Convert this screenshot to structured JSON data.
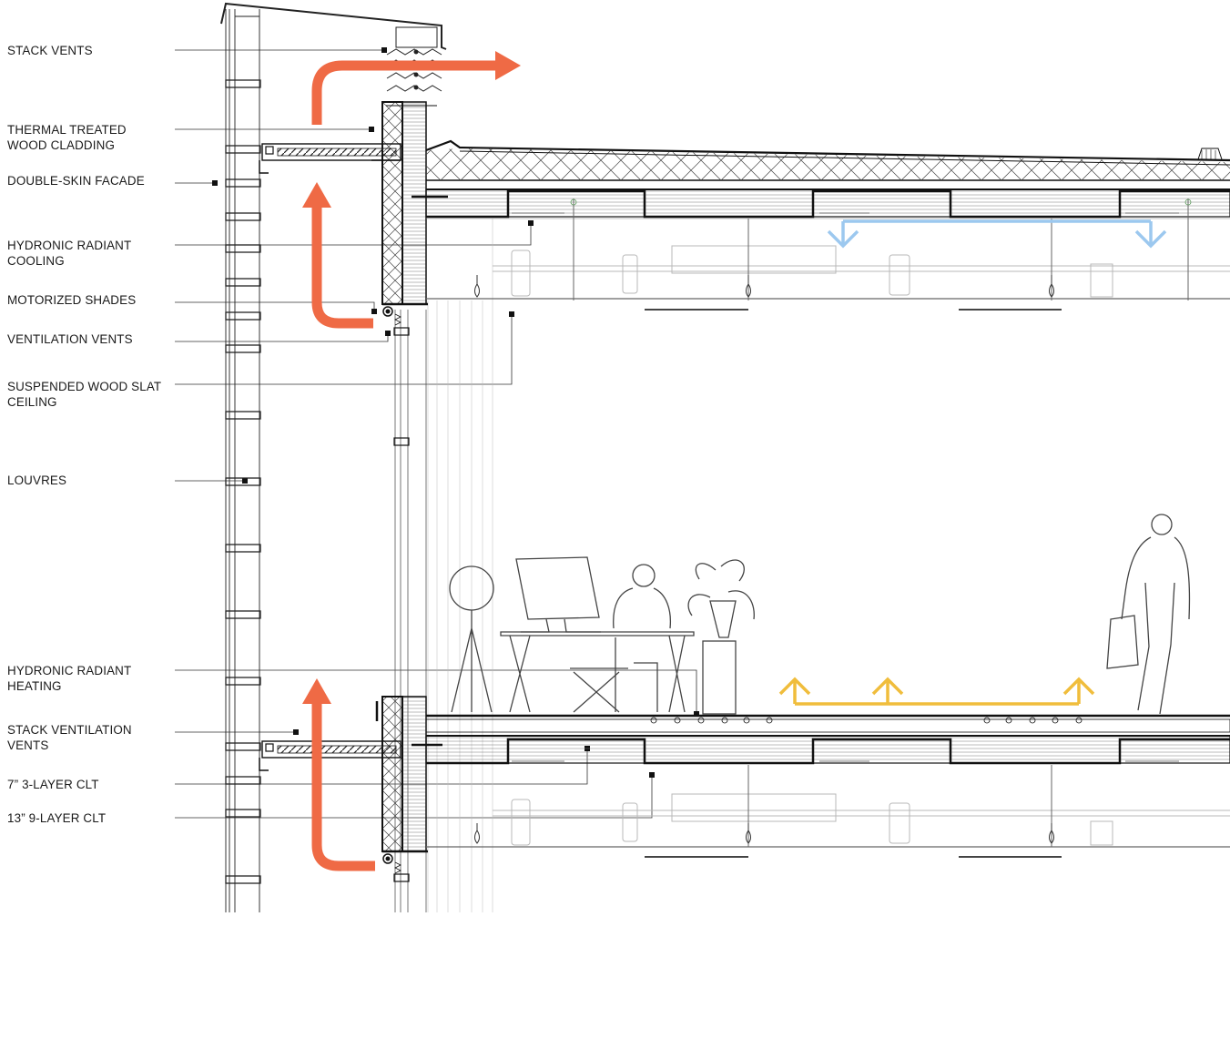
{
  "labels": [
    {
      "id": "stack-vents",
      "text": "STACK VENTS"
    },
    {
      "id": "thermal-cladding",
      "text": "THERMAL TREATED\nWOOD CLADDING"
    },
    {
      "id": "double-skin",
      "text": "DOUBLE-SKIN FACADE"
    },
    {
      "id": "radiant-cooling",
      "text": "HYDRONIC RADIANT\nCOOLING"
    },
    {
      "id": "motorized-shades",
      "text": "MOTORIZED SHADES"
    },
    {
      "id": "ventilation-vents",
      "text": "VENTILATION VENTS"
    },
    {
      "id": "wood-slat-ceiling",
      "text": "SUSPENDED WOOD SLAT\nCEILING"
    },
    {
      "id": "louvres",
      "text": "LOUVRES"
    },
    {
      "id": "radiant-heating",
      "text": "HYDRONIC RADIANT\nHEATING"
    },
    {
      "id": "stack-ventilation-vents",
      "text": "STACK VENTILATION\nVENTS"
    },
    {
      "id": "clt-3-layer",
      "text": "7” 3-LAYER CLT"
    },
    {
      "id": "clt-9-layer",
      "text": "13” 9-LAYER CLT"
    }
  ],
  "colors": {
    "warm_air": "#ef6a45",
    "cool_air": "#9cc8ef",
    "radiant_heat": "#f0bd3c",
    "linework": "#1a1a1a",
    "light_linework": "#bdbdbd"
  },
  "icons": [
    "warm-air-arrow",
    "cooling-arrow",
    "heating-arrow",
    "person-walking-icon",
    "person-seated-icon",
    "plant-icon",
    "lamp-icon",
    "monitor-icon"
  ]
}
